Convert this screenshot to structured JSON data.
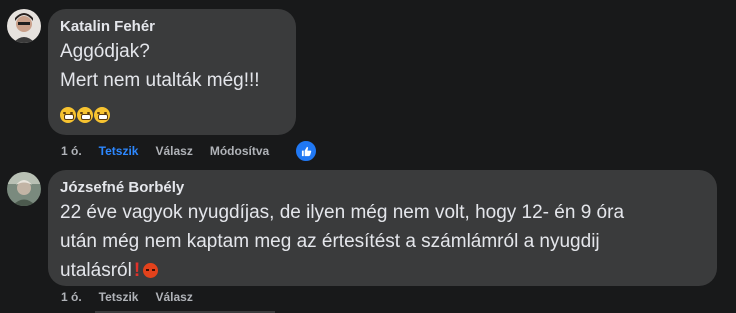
{
  "comments": [
    {
      "author": "Katalin Fehér",
      "lines": [
        "Aggódjak?",
        "Mert nem utalták még!!!"
      ],
      "emoji_names": [
        "tired-face-icon",
        "tired-face-icon",
        "tired-face-icon"
      ],
      "actions": {
        "time": "1 ó.",
        "like": "Tetszik",
        "reply": "Válasz",
        "edited": "Módosítva"
      },
      "like_state": "liked",
      "reaction": "like-reaction-icon"
    },
    {
      "author": "Józsefné Borbély",
      "lines": [
        "22 éve vagyok nyugdíjas, de ilyen még nem volt, hogy 12- én 9 óra",
        "után még nem kaptam meg az értesítést a számlámról a nyugdij",
        "utalásról"
      ],
      "trailing_emojis": [
        "exclamation-icon",
        "angry-face-icon"
      ],
      "actions": {
        "time": "1 ó.",
        "like": "Tetszik",
        "reply": "Válasz"
      }
    }
  ],
  "colors": {
    "background": "#18191a",
    "bubble": "#3a3b3c",
    "text": "#e4e6eb",
    "secondary": "#b0b3b8",
    "accent": "#2d88ff"
  }
}
